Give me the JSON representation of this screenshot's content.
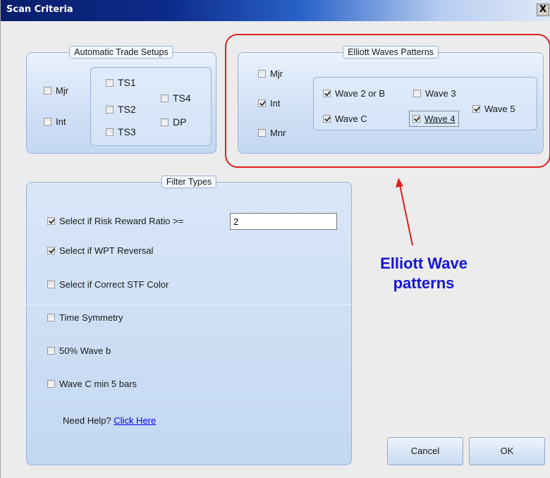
{
  "window": {
    "title": "Scan Criteria",
    "close_label": "X"
  },
  "automatic_trade_setups": {
    "title": "Automatic Trade Setups",
    "left": [
      {
        "label": "Mjr",
        "checked": false
      },
      {
        "label": "Int",
        "checked": false
      }
    ],
    "setups": [
      {
        "label": "TS1",
        "checked": false
      },
      {
        "label": "TS2",
        "checked": false
      },
      {
        "label": "TS3",
        "checked": false
      },
      {
        "label": "TS4",
        "checked": false
      },
      {
        "label": "DP",
        "checked": false
      }
    ]
  },
  "elliott_waves": {
    "title": "Elliott Waves Patterns",
    "degrees": [
      {
        "label": "Mjr",
        "checked": false
      },
      {
        "label": "Int",
        "checked": true
      },
      {
        "label": "Mnr",
        "checked": false
      }
    ],
    "waves": [
      {
        "label": "Wave 2 or B",
        "checked": true
      },
      {
        "label": "Wave 3",
        "checked": false
      },
      {
        "label": "Wave C",
        "checked": true
      },
      {
        "label": "Wave 4",
        "checked": true,
        "focused": true
      },
      {
        "label": "Wave 5",
        "checked": true
      }
    ]
  },
  "filter_types": {
    "title": "Filter Types",
    "items": [
      {
        "label": "Select if Risk Reward Ratio >=",
        "checked": true
      },
      {
        "label": "Select if WPT Reversal",
        "checked": true
      },
      {
        "label": "Select if Correct STF Color",
        "checked": false
      },
      {
        "label": "Time Symmetry",
        "checked": false
      },
      {
        "label": "50% Wave b",
        "checked": false
      },
      {
        "label": "Wave C min 5 bars",
        "checked": false
      }
    ],
    "risk_reward_value": "2",
    "help_text": "Need Help?",
    "help_link": "Click Here"
  },
  "buttons": {
    "cancel": "Cancel",
    "ok": "OK"
  },
  "annotation": {
    "text": "Elliott Wave patterns",
    "color": "#1515d8",
    "ring_color": "#e02020"
  }
}
